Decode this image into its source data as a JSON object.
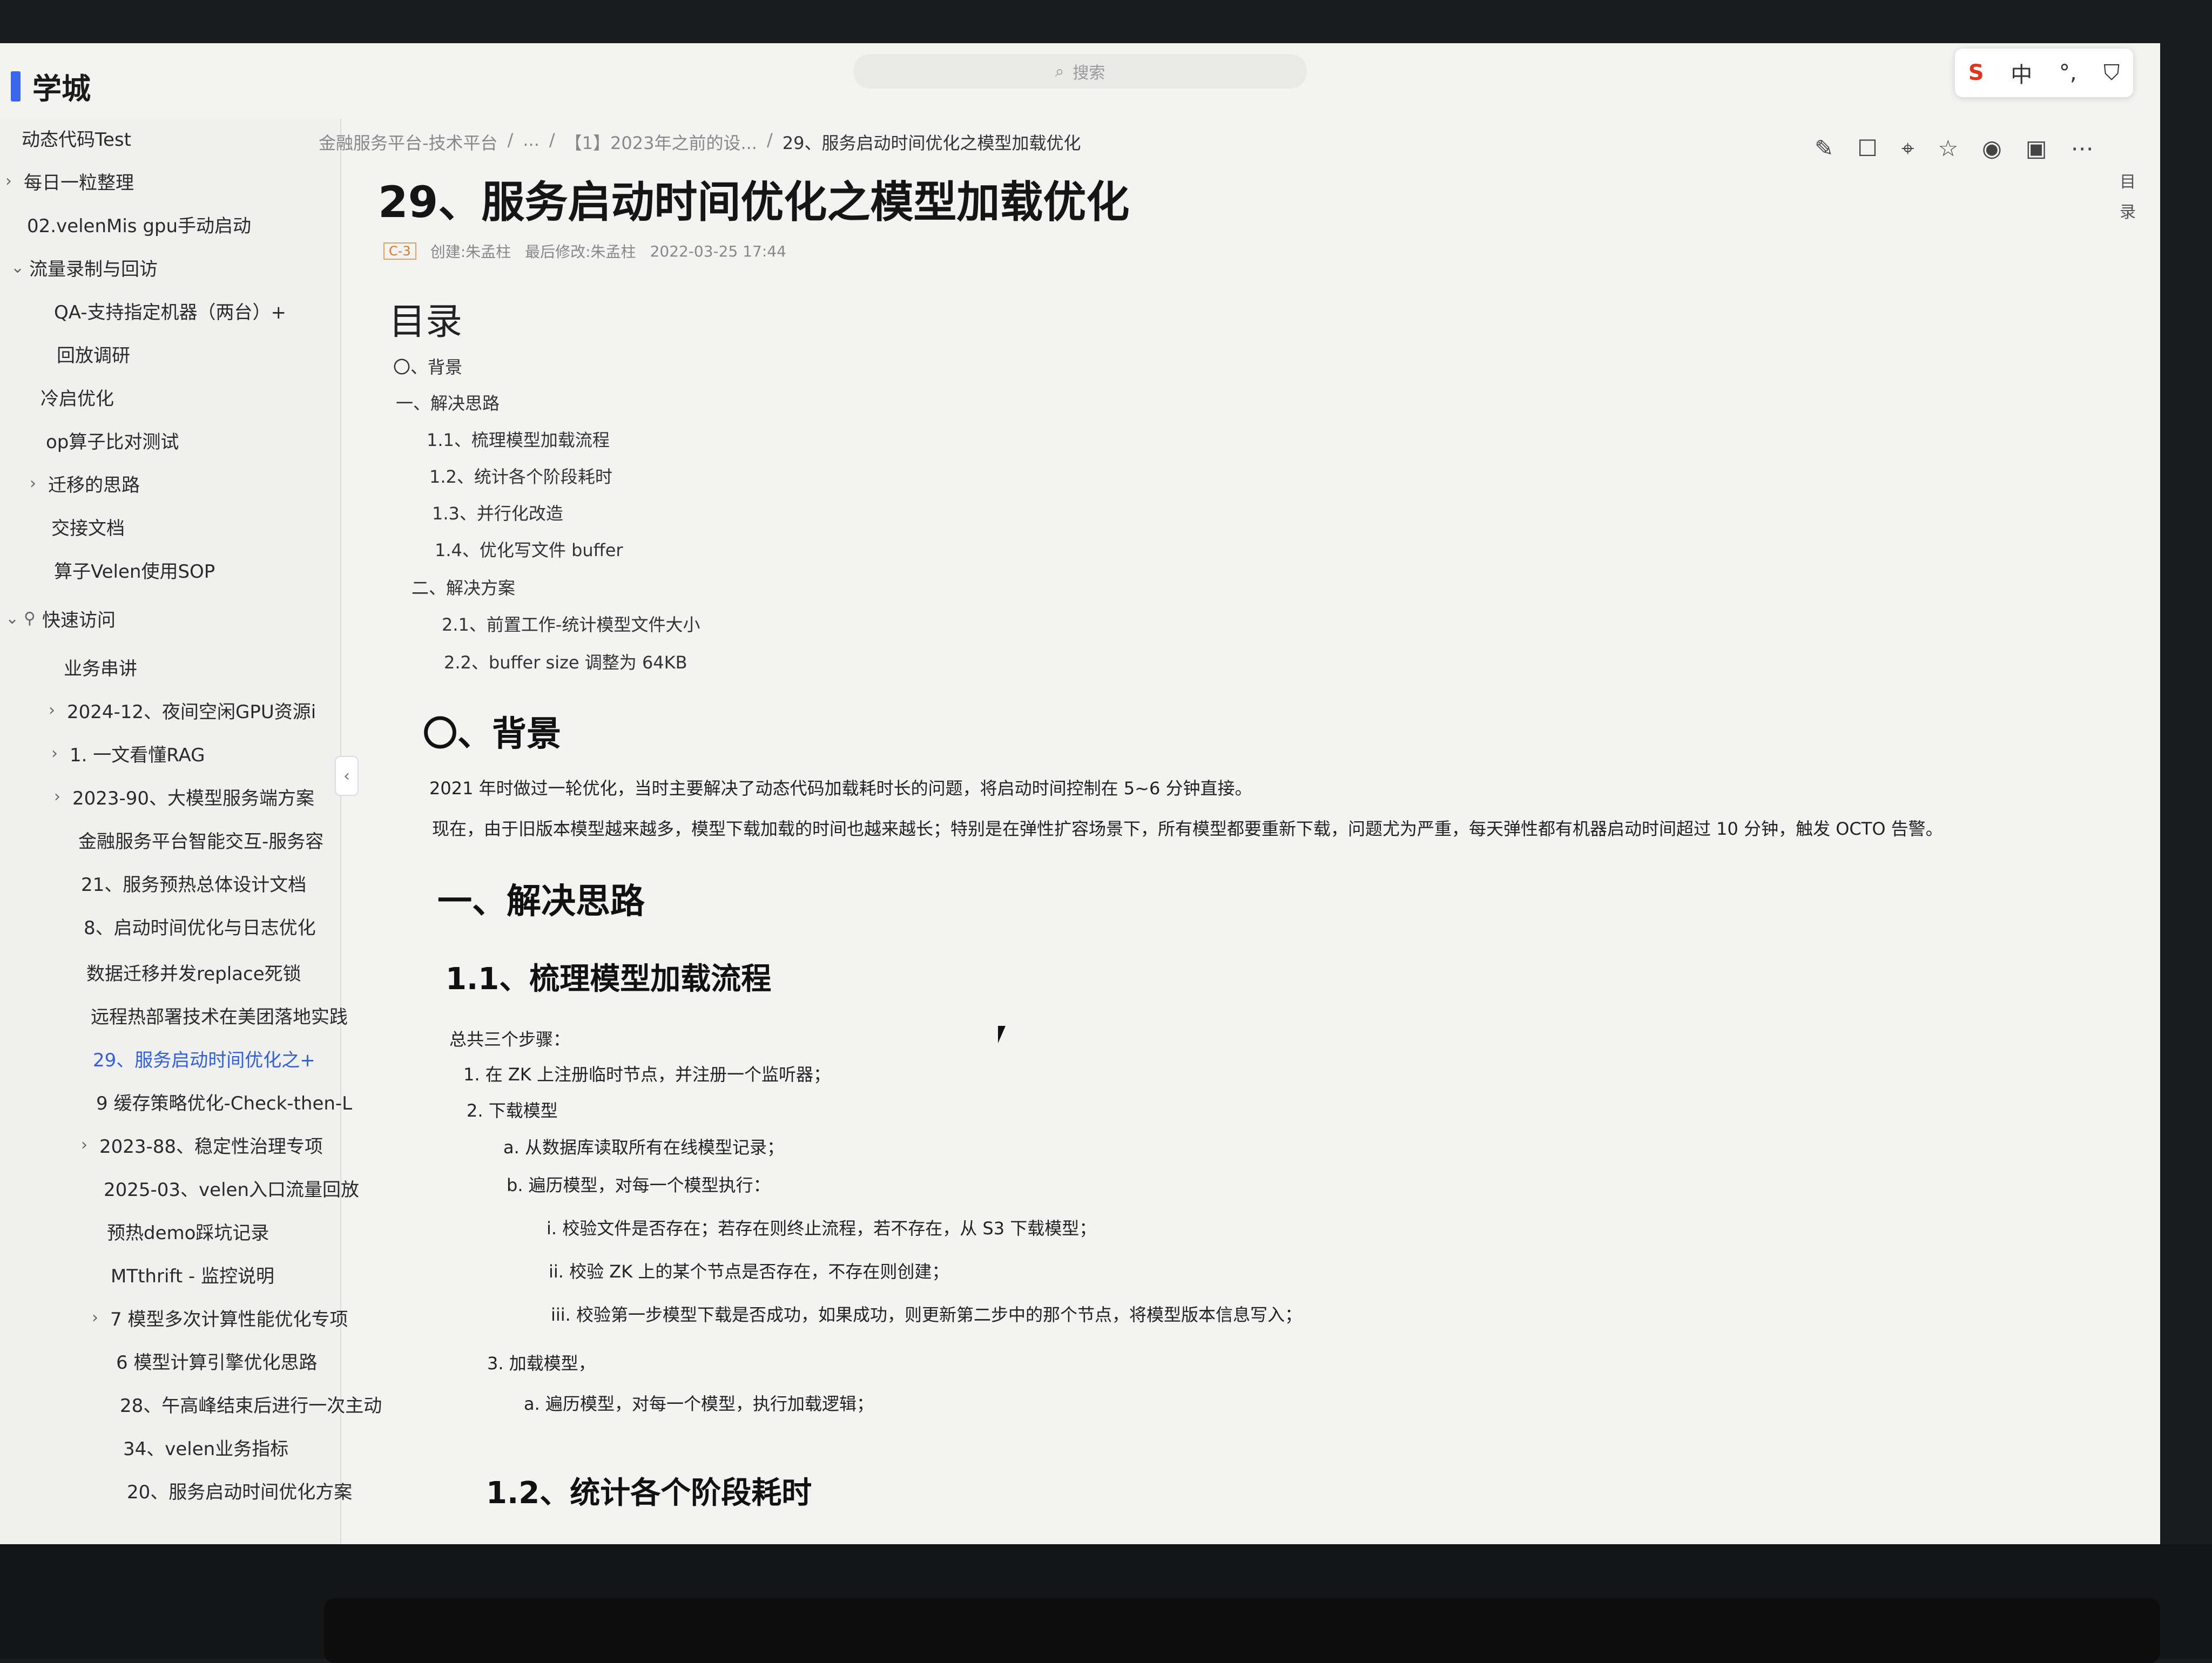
{
  "app": {
    "name": "学城"
  },
  "search": {
    "placeholder": "搜索"
  },
  "tray": {
    "brand": "S",
    "ime": "中",
    "punct": "°,",
    "shirt": "⛉"
  },
  "toolbar": {
    "icons": [
      "edit-icon",
      "presentation-icon",
      "pin-icon",
      "star-icon",
      "eye-icon",
      "lock-icon",
      "more-icon"
    ]
  },
  "sidebar": {
    "items": [
      "动态代码Test",
      "每日一粒整理",
      "02.velenMis gpu手动启动",
      "流量录制与回访",
      "QA-支持指定机器（两台）+",
      "回放调研",
      "冷启优化",
      "op算子比对测试",
      "迁移的思路",
      "交接文档",
      "算子Velen使用SOP",
      "快速访问",
      "业务串讲",
      "2024-12、夜间空闲GPU资源i",
      "1. 一文看懂RAG",
      "2023-90、大模型服务端方案",
      "金融服务平台智能交互-服务容",
      "21、服务预热总体设计文档",
      "8、启动时间优化与日志优化",
      "数据迁移并发replace死锁",
      "远程热部署技术在美团落地实践",
      "29、服务启动时间优化之+",
      "9 缓存策略优化-Check-then-L",
      "2023-88、稳定性治理专项",
      "2025-03、velen入口流量回放",
      "预热demo踩坑记录",
      "MTthrift - 监控说明",
      "7 模型多次计算性能优化专项",
      "6 模型计算引擎优化思路",
      "28、午高峰结束后进行一次主动",
      "34、velen业务指标",
      "20、服务启动时间优化方案"
    ]
  },
  "breadcrumb": {
    "root": "金融服务平台-技术平台",
    "sep": "/",
    "ellipsis": "...",
    "parent": "【1】2023年之前的设...",
    "current": "29、服务启动时间优化之模型加载优化"
  },
  "doc": {
    "title": "29、服务启动时间优化之模型加载优化",
    "tag": "C-3",
    "creator": "创建:朱孟柱",
    "modifier": "最后修改:朱孟柱",
    "modified_at": "2022-03-25 17:44",
    "toc_side_label": [
      "目",
      "录"
    ],
    "toc_heading": "目录",
    "toc": [
      "〇、背景",
      "一、解决思路",
      "1.1、梳理模型加载流程",
      "1.2、统计各个阶段耗时",
      "1.3、并行化改造",
      "1.4、优化写文件 buffer",
      "二、解决方案",
      "2.1、前置工作-统计模型文件大小",
      "2.2、buffer size 调整为 64KB"
    ],
    "section0_heading": "〇、背景",
    "section0_p1": "2021 年时做过一轮优化，当时主要解决了动态代码加载耗时长的问题，将启动时间控制在 5~6 分钟直接。",
    "section0_p2": "2021 年时做过一轮优化，当时主要解决了动态代码加载耗时长的问题，将启动时间控制在 5~6 分钟直接。",
    "background_p1": "2021 年时做过一轮优化，当时主要解决了动态代码加载耗时长的问题，将启动时间控制在 5~6 分钟直接。",
    "background_p2": "现在，由于旧版本模型越来越多，模型下载加载的时间也越来越长；特别是在弹性扩容场景下，所有模型都要重新下载，问题尤为严重，每天弹性都有机器启动时间超过 10 分钟，触发 OCTO 告警。",
    "section1_heading": "一、解决思路",
    "section11_heading": "1.1、梳理模型加载流程",
    "steps_intro": "总共三个步骤：",
    "step1": "1. 在 ZK 上注册临时节点，并注册一个监听器；",
    "step2": "2. 下载模型",
    "step2a": "a. 从数据库读取所有在线模型记录；",
    "step2b": "b. 遍历模型，对每一个模型执行：",
    "step2b_i": "i. 校验文件是否存在；若存在则终止流程，若不存在，从 S3 下载模型；",
    "step2b_ii": "ii. 校验 ZK 上的某个节点是否存在，不存在则创建；",
    "step2b_iii": "iii. 校验第一步模型下载是否成功，如果成功，则更新第二步中的那个节点，将模型版本信息写入；",
    "step3": "3. 加载模型，",
    "step3a": "a. 遍历模型，对每一个模型，执行加载逻辑；",
    "section12_heading": "1.2、统计各个阶段耗时"
  }
}
